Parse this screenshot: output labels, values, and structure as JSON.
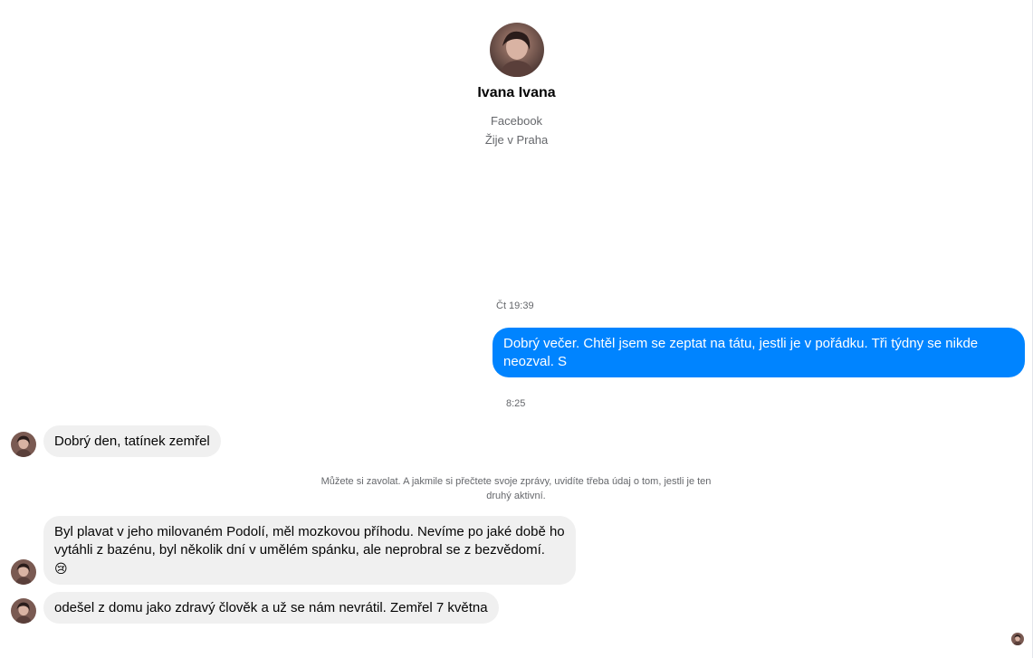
{
  "profile": {
    "name": "Ivana Ivana",
    "source": "Facebook",
    "location": "Žije v Praha"
  },
  "conversation": {
    "timestamp_1": "Čt 19:39",
    "outgoing_1": "Dobrý večer. Chtěl jsem se zeptat na tátu, jestli je v pořádku. Tři týdny se nikde neozval. S",
    "timestamp_2": "8:25",
    "incoming_1": "Dobrý den, tatínek zemřel",
    "notice": "Můžete si zavolat. A jakmile si přečtete svoje zprávy, uvidíte třeba údaj o tom, jestli je ten druhý aktivní.",
    "incoming_2": "Byl plavat v jeho milovaném Podolí, měl mozkovou příhodu. Nevíme po jaké době ho vytáhli z bazénu, byl několik dní v umělém spánku, ale neprobral se z bezvědomí.",
    "incoming_2_emoji": "😢",
    "incoming_3": "odešel z domu jako zdravý člověk a už se nám nevrátil. Zemřel 7 května"
  },
  "colors": {
    "outgoing_bubble": "#0084ff",
    "incoming_bubble": "#f0f0f0",
    "secondary_text": "#65676b"
  }
}
